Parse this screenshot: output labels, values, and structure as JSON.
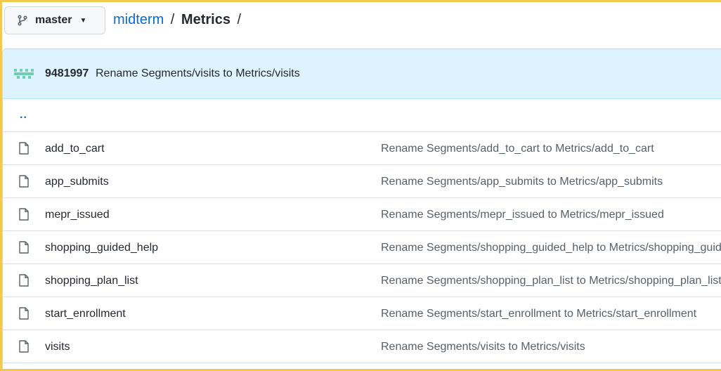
{
  "header": {
    "branch_label": "master",
    "breadcrumb_root": "midterm",
    "breadcrumb_sep": "/",
    "breadcrumb_current": "Metrics",
    "breadcrumb_trailing_sep": "/"
  },
  "commit": {
    "hash": "9481997",
    "message": "Rename Segments/visits to Metrics/visits"
  },
  "parent_link": "..",
  "files": [
    {
      "name": "add_to_cart",
      "commit_message": "Rename Segments/add_to_cart to Metrics/add_to_cart"
    },
    {
      "name": "app_submits",
      "commit_message": "Rename Segments/app_submits to Metrics/app_submits"
    },
    {
      "name": "mepr_issued",
      "commit_message": "Rename Segments/mepr_issued to Metrics/mepr_issued"
    },
    {
      "name": "shopping_guided_help",
      "commit_message": "Rename Segments/shopping_guided_help to Metrics/shopping_guided_help"
    },
    {
      "name": "shopping_plan_list",
      "commit_message": "Rename Segments/shopping_plan_list to Metrics/shopping_plan_list"
    },
    {
      "name": "start_enrollment",
      "commit_message": "Rename Segments/start_enrollment to Metrics/start_enrollment"
    },
    {
      "name": "visits",
      "commit_message": "Rename Segments/visits to Metrics/visits"
    }
  ],
  "icons": {
    "branch": "git-branch-icon",
    "caret": "chevron-down-icon",
    "file": "file-icon",
    "avatar": "identicon-avatar"
  },
  "colors": {
    "link": "#0969da",
    "commit_bar": "#ddf4ff",
    "frame_highlight": "#f2c94c",
    "avatar": "#6fcfb0"
  }
}
